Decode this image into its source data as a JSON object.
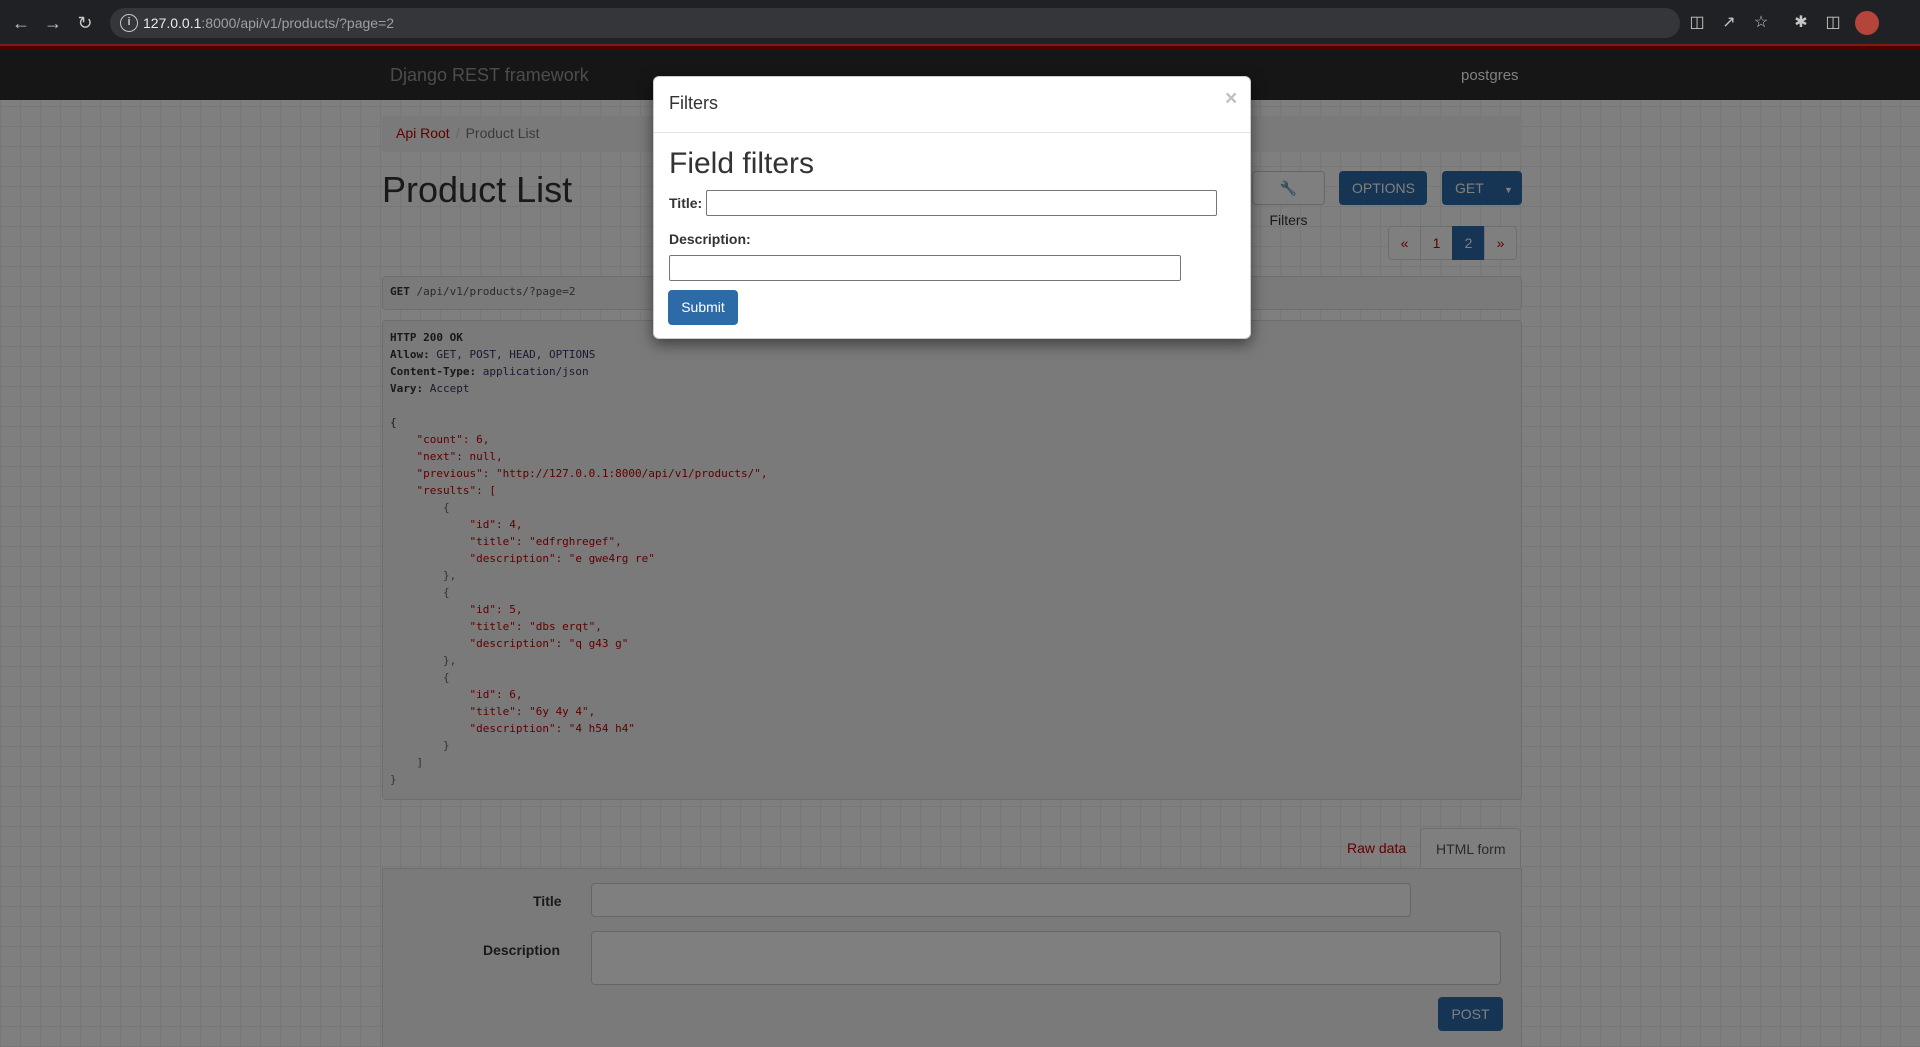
{
  "browser": {
    "url_host": "127.0.0.1",
    "url_rest": ":8000/api/v1/products/?page=2"
  },
  "navbar": {
    "brand": "Django REST framework",
    "user": "postgres"
  },
  "breadcrumb": {
    "root": "Api Root",
    "separator": "/",
    "current": "Product List"
  },
  "page_title": "Product List",
  "buttons": {
    "filters": "Filters",
    "options": "OPTIONS",
    "get": "GET"
  },
  "pagination": {
    "prev": "«",
    "pages": [
      "1",
      "2"
    ],
    "next": "»"
  },
  "request": {
    "method": "GET",
    "path": "/api/v1/products/?page=2"
  },
  "response": {
    "status": "HTTP 200 OK",
    "headers": [
      {
        "name": "Allow:",
        "value": "GET, POST, HEAD, OPTIONS"
      },
      {
        "name": "Content-Type:",
        "value": "application/json"
      },
      {
        "name": "Vary:",
        "value": "Accept"
      }
    ],
    "body_lines": [
      "{",
      "    \"count\": 6,",
      "    \"next\": null,",
      "    \"previous\": \"http://127.0.0.1:8000/api/v1/products/\",",
      "    \"results\": [",
      "        {",
      "            \"id\": 4,",
      "            \"title\": \"edfrghregef\",",
      "            \"description\": \"e gwe4rg re\"",
      "        },",
      "        {",
      "            \"id\": 5,",
      "            \"title\": \"dbs erqt\",",
      "            \"description\": \"q g43 g\"",
      "        },",
      "        {",
      "            \"id\": 6,",
      "            \"title\": \"6y 4y 4\",",
      "            \"description\": \"4 h54 h4\"",
      "        }",
      "    ]",
      "}"
    ]
  },
  "form_tabs": {
    "raw": "Raw data",
    "html": "HTML form"
  },
  "post_form": {
    "title_label": "Title",
    "description_label": "Description",
    "submit": "POST"
  },
  "modal": {
    "title": "Filters",
    "close": "×",
    "heading": "Field filters",
    "title_label": "Title:",
    "description_label": "Description:",
    "submit": "Submit"
  }
}
